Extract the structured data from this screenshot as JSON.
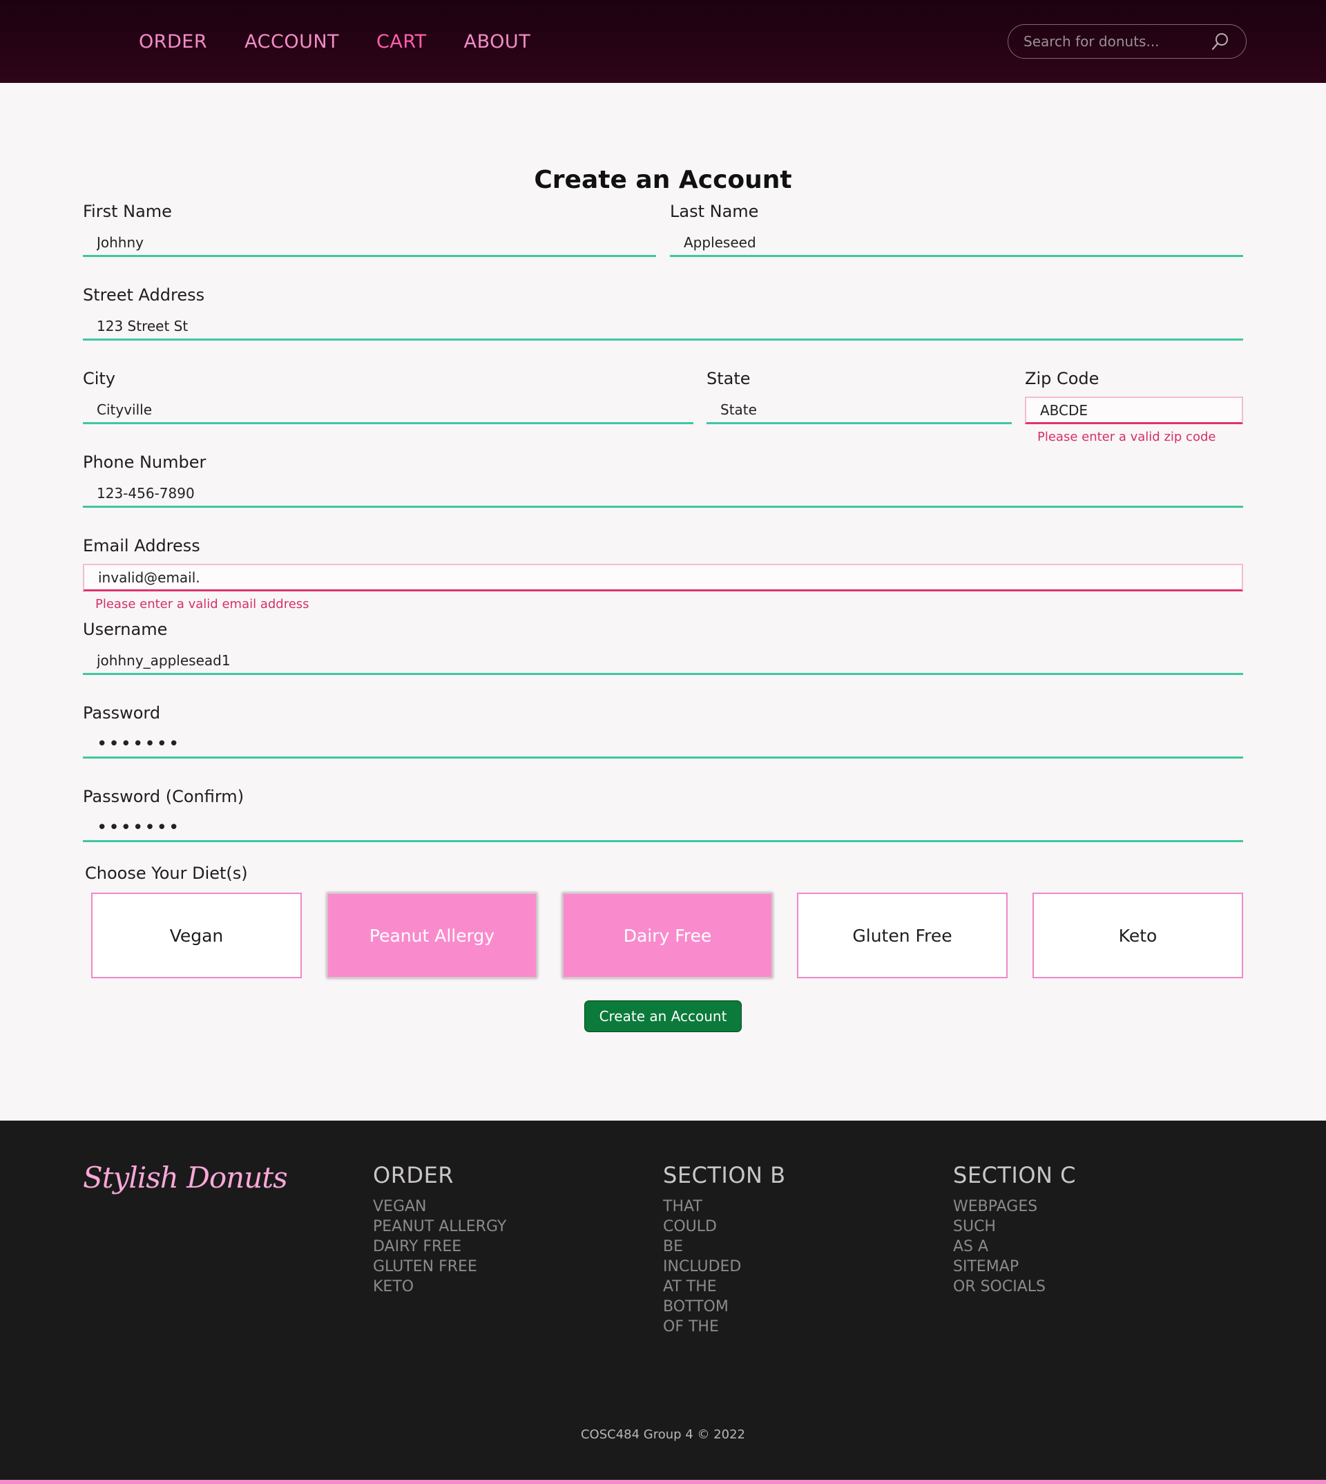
{
  "nav": {
    "links": [
      "ORDER",
      "ACCOUNT",
      "CART",
      "ABOUT"
    ],
    "active_link": "CART",
    "search_placeholder": "Search for donuts...",
    "search_icon": "search-icon"
  },
  "form": {
    "title": "Create an Account",
    "first_name": {
      "label": "First Name",
      "value": "Johhny"
    },
    "last_name": {
      "label": "Last Name",
      "value": "Appleseed"
    },
    "street": {
      "label": "Street Address",
      "value": "123 Street St"
    },
    "city": {
      "label": "City",
      "value": "Cityville"
    },
    "state": {
      "label": "State",
      "value": "State"
    },
    "zip": {
      "label": "Zip Code",
      "value": "ABCDE",
      "error": "Please enter a valid zip code"
    },
    "phone": {
      "label": "Phone Number",
      "value": "123-456-7890"
    },
    "email": {
      "label": "Email Address",
      "value": "invalid@email.",
      "error": "Please enter a valid email address"
    },
    "username": {
      "label": "Username",
      "value": "johhny_applesead1"
    },
    "password": {
      "label": "Password",
      "value": "•••••••"
    },
    "password_confirm": {
      "label": "Password (Confirm)",
      "value": "•••••••"
    },
    "diet_label": "Choose Your Diet(s)",
    "diets": [
      {
        "label": "Vegan",
        "selected": false
      },
      {
        "label": "Peanut Allergy",
        "selected": true
      },
      {
        "label": "Dairy Free",
        "selected": true
      },
      {
        "label": "Gluten Free",
        "selected": false
      },
      {
        "label": "Keto",
        "selected": false
      }
    ],
    "submit_label": "Create an Account"
  },
  "footer": {
    "logo": "Stylish Donuts",
    "columns": [
      {
        "heading": "ORDER",
        "items": [
          "VEGAN",
          "PEANUT ALLERGY",
          "DAIRY FREE",
          "GLUTEN FREE",
          "KETO"
        ]
      },
      {
        "heading": "SECTION B",
        "items": [
          "THAT",
          "COULD",
          "BE",
          "INCLUDED",
          "AT THE",
          "BOTTOM",
          "OF THE"
        ]
      },
      {
        "heading": "SECTION C",
        "items": [
          "WEBPAGES",
          "SUCH",
          "AS A",
          "SITEMAP",
          "OR SOCIALS"
        ]
      }
    ],
    "copyright": "COSC484 Group 4 © 2022"
  },
  "colors": {
    "accent_pink": "#f98bcd",
    "valid_underline": "#3ec7a2",
    "error": "#d62f6a",
    "submit": "#0b7a3b"
  }
}
